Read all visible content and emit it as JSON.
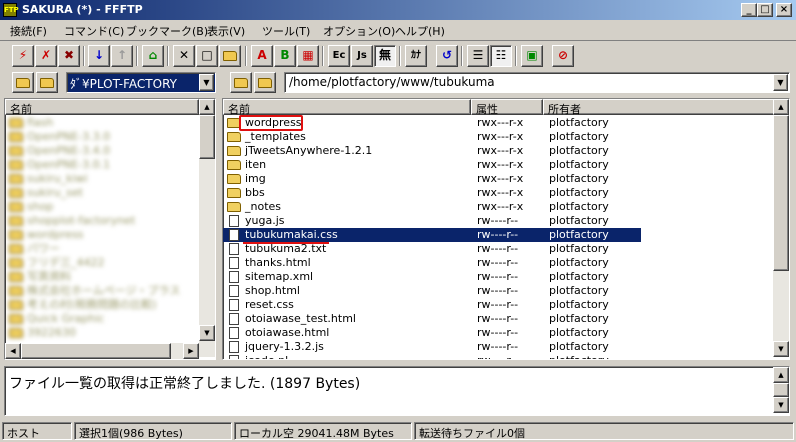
{
  "window": {
    "title": "SAKURA (*) - FFFTP",
    "icon_label": "FTP"
  },
  "caption_buttons": {
    "minimize": "_",
    "maximize": "□",
    "close": "×"
  },
  "menu": [
    "接続(F)",
    "コマンド(C)",
    "ブックマーク(B)",
    "表示(V)",
    "ツール(T)",
    "オプション(O)",
    "ヘルプ(H)"
  ],
  "toolbar": {
    "connect_icon": "plug-icon",
    "download": "↓",
    "upload": "↑",
    "home": "⌂",
    "delete": "✕",
    "ascii": "A",
    "binary": "B",
    "euc": "Ec",
    "jis": "Js",
    "no_convert": "無",
    "kana": "ｶﾅ",
    "refresh": "↺",
    "stop": "⊘"
  },
  "paths": {
    "local": "ﾃﾞｽｸﾄｯﾌﾟ¥PLOT-FACTORY",
    "local_visible": "ﾀﾞ¥PLOT-FACTORY",
    "remote": "/home/plotfactory/www/tubukuma"
  },
  "local_pane": {
    "header": "名前",
    "items": [
      "flash",
      "OpenPNE-3.3.0",
      "OpenPNE-3.4.0",
      "OpenPNE-3.0.1",
      "sukiru_kiwi",
      "sukiru_set",
      "shop",
      "shopplot-factorynet",
      "wordpress",
      "パワー",
      "フリデ三_4422",
      "写真資料",
      "株式会社ホームページ・プラス",
      "考えの村(税務問題の比較)",
      "Quick Graphic",
      "3922630"
    ]
  },
  "remote_pane": {
    "headers": {
      "name": "名前",
      "attr": "属性",
      "owner": "所有者"
    },
    "rows": [
      {
        "name": "wordpress",
        "type": "folder",
        "attr": "rwx---r-x",
        "owner": "plotfactory"
      },
      {
        "name": "_templates",
        "type": "folder",
        "attr": "rwx---r-x",
        "owner": "plotfactory"
      },
      {
        "name": "jTweetsAnywhere-1.2.1",
        "type": "folder",
        "attr": "rwx---r-x",
        "owner": "plotfactory"
      },
      {
        "name": "iten",
        "type": "folder",
        "attr": "rwx---r-x",
        "owner": "plotfactory"
      },
      {
        "name": "img",
        "type": "folder",
        "attr": "rwx---r-x",
        "owner": "plotfactory"
      },
      {
        "name": "bbs",
        "type": "folder",
        "attr": "rwx---r-x",
        "owner": "plotfactory"
      },
      {
        "name": "_notes",
        "type": "folder",
        "attr": "rwx---r-x",
        "owner": "plotfactory"
      },
      {
        "name": "yuga.js",
        "type": "file",
        "attr": "rw----r--",
        "owner": "plotfactory"
      },
      {
        "name": "tubukumakai.css",
        "type": "file",
        "attr": "rw----r--",
        "owner": "plotfactory",
        "selected": true
      },
      {
        "name": "tubukuma2.txt",
        "type": "file",
        "attr": "rw----r--",
        "owner": "plotfactory"
      },
      {
        "name": "thanks.html",
        "type": "file",
        "attr": "rw----r--",
        "owner": "plotfactory"
      },
      {
        "name": "sitemap.xml",
        "type": "file",
        "attr": "rw----r--",
        "owner": "plotfactory"
      },
      {
        "name": "shop.html",
        "type": "file",
        "attr": "rw----r--",
        "owner": "plotfactory"
      },
      {
        "name": "reset.css",
        "type": "file",
        "attr": "rw----r--",
        "owner": "plotfactory"
      },
      {
        "name": "otoiawase_test.html",
        "type": "file",
        "attr": "rw----r--",
        "owner": "plotfactory"
      },
      {
        "name": "otoiawase.html",
        "type": "file",
        "attr": "rw----r--",
        "owner": "plotfactory"
      },
      {
        "name": "jquery-1.3.2.js",
        "type": "file",
        "attr": "rw----r--",
        "owner": "plotfactory"
      },
      {
        "name": "jcode.pl",
        "type": "file",
        "attr": "rw----r--",
        "owner": "plotfactory"
      }
    ]
  },
  "log": {
    "message": "ファイル一覧の取得は正常終了しました. (1897 Bytes)"
  },
  "status": {
    "host": "ホスト",
    "selection": "選択1個(986 Bytes)",
    "local_free": "ローカル空 29041.48M Bytes",
    "queue": "転送待ちファイル0個"
  }
}
